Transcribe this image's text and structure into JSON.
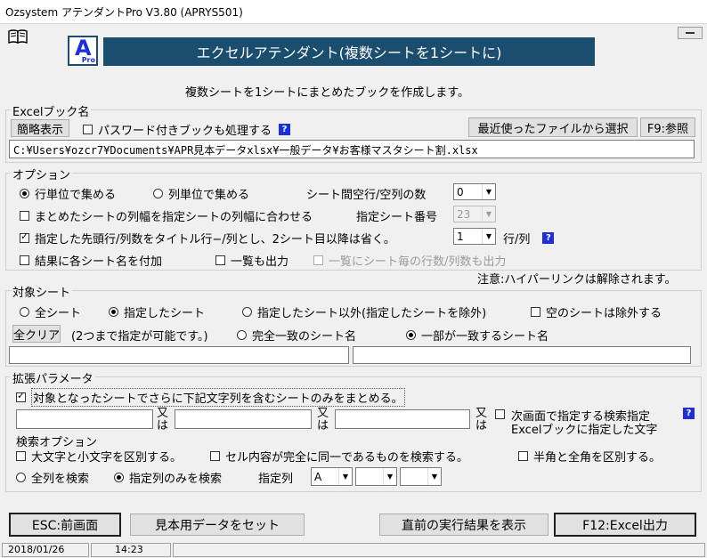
{
  "window": {
    "title": "Ozsystem アテンダントPro V3.80 (APRYS501)"
  },
  "header": {
    "logo_text": "A",
    "logo_sub": "Pro",
    "banner": "エクセルアテンダント(複数シートを1シートに)",
    "description": "複数シートを1シートにまとめたブックを作成します。"
  },
  "excel_book": {
    "legend": "Excelブック名",
    "brief_button": "簡略表示",
    "password_label": "パスワード付きブックも処理する",
    "help": "?",
    "recent_button": "最近使ったファイルから選択",
    "browse_button": "F9:参照",
    "path": "C:¥Users¥ozcr7¥Documents¥APR見本データxlsx¥一般データ¥お客様マスタシート割.xlsx"
  },
  "options": {
    "legend": "オプション",
    "row_unit": "行単位で集める",
    "col_unit": "列単位で集める",
    "gap_label": "シート間空行/空列の数",
    "gap_value": "0",
    "match_width": "まとめたシートの列幅を指定シートの列幅に合わせる",
    "sheet_no_label": "指定シート番号",
    "sheet_no_value": "23",
    "title_rows": "指定した先頭行/列数をタイトル行−/列とし、2シート目以降は省く。",
    "title_rows_value": "1",
    "title_rows_unit": "行/列",
    "help": "?",
    "append_name": "結果に各シート名を付加",
    "output_list": "一覧も出力",
    "list_counts": "一覧にシート毎の行数/列数も出力",
    "note": "注意:ハイパーリンクは解除されます。"
  },
  "target": {
    "legend": "対象シート",
    "all": "全シート",
    "specified": "指定したシート",
    "except": "指定したシート以外(指定したシートを除外)",
    "exclude_empty": "空のシートは除外する",
    "clear_button": "全クリア",
    "hint": "(2つまで指定が可能です。)",
    "exact": "完全一致のシート名",
    "partial": "一部が一致するシート名",
    "input1": "",
    "input2": ""
  },
  "extended": {
    "legend": "拡張パラメータ",
    "contains": "対象となったシートでさらに下記文字列を含むシートのみをまとめる。",
    "or1": "又は",
    "or2": "又は",
    "or3": "又は",
    "next_screen_1": "次画面で指定する検索指定",
    "next_screen_2": "Excelブックに指定した文字",
    "help": "?",
    "search_options": "検索オプション",
    "case": "大文字と小文字を区別する。",
    "whole_cell": "セル内容が完全に同一であるものを検索する。",
    "width": "半角と全角を区別する。",
    "all_cols": "全列を検索",
    "spec_cols": "指定列のみを検索",
    "col_label": "指定列",
    "col1": "A",
    "col2": "",
    "col3": ""
  },
  "footer": {
    "esc": "ESC:前画面",
    "sample": "見本用データをセット",
    "last_result": "直前の実行結果を表示",
    "f12": "F12:Excel出力"
  },
  "status": {
    "date": "2018/01/26",
    "time": "14:23"
  },
  "colors": {
    "banner_bg": "#1b4e6e",
    "help_bg": "#1d2fd8",
    "logo_text": "#1d2fd8"
  }
}
